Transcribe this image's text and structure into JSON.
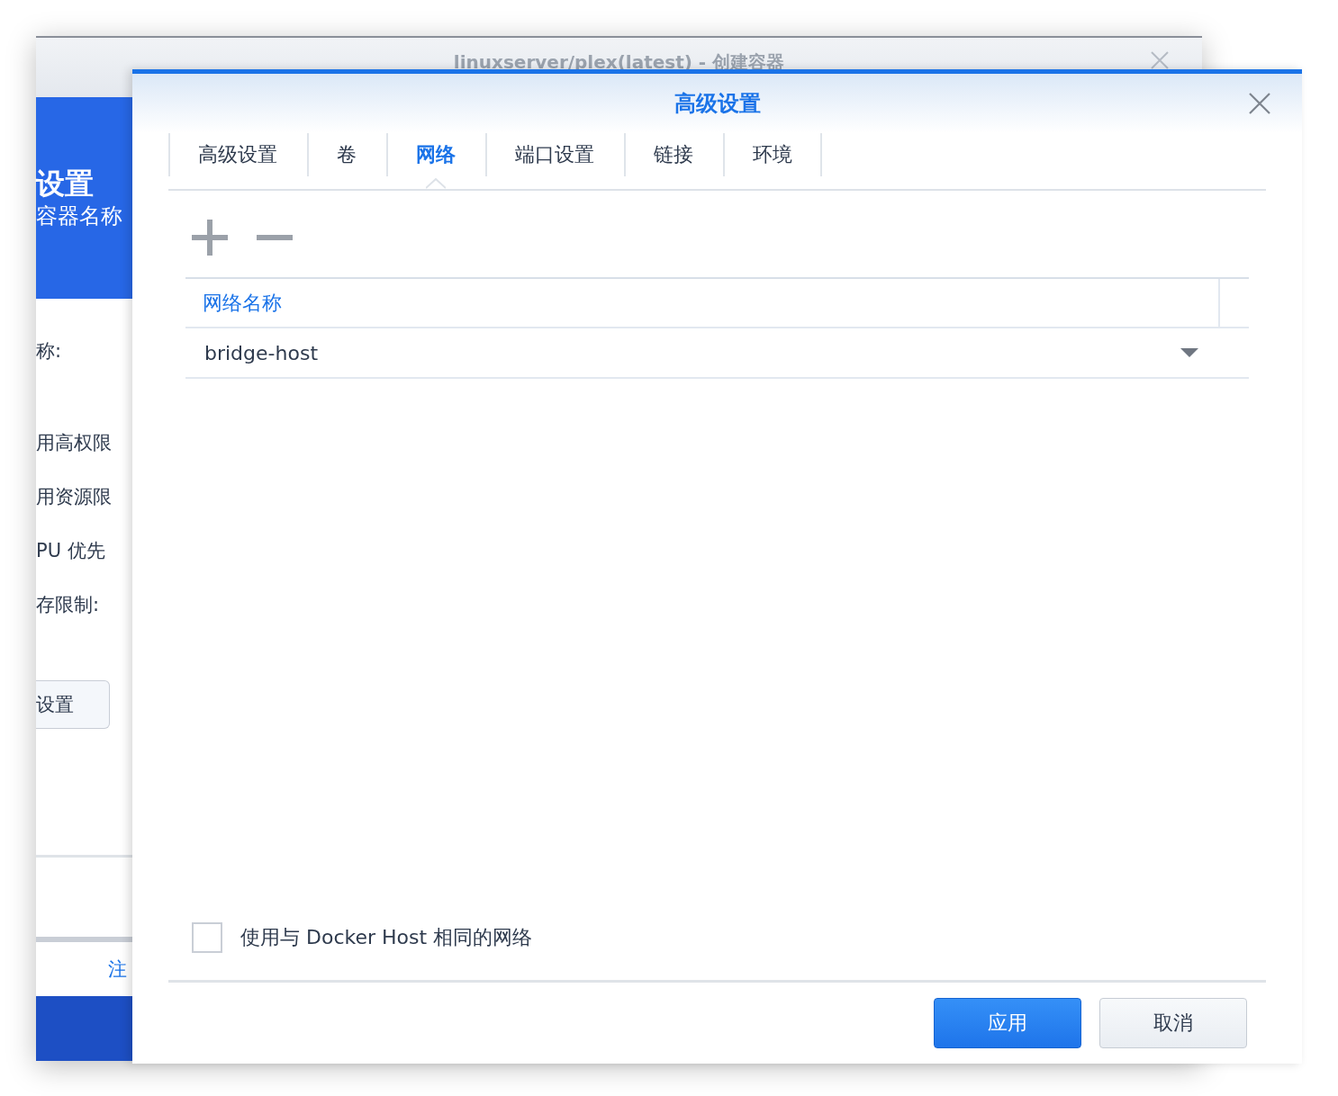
{
  "background_window": {
    "title": "linuxserver/plex(latest) - 创建容器",
    "banner_title": "设置",
    "banner_subtitle": "容器名称",
    "labels": [
      "称:",
      "用高权限",
      "用资源限",
      "PU 优先",
      "存限制:"
    ],
    "button": "设置",
    "link": "注"
  },
  "dialog": {
    "title": "高级设置",
    "tabs": [
      {
        "label": "高级设置",
        "selected": false
      },
      {
        "label": "卷",
        "selected": false
      },
      {
        "label": "网络",
        "selected": true
      },
      {
        "label": "端口设置",
        "selected": false
      },
      {
        "label": "链接",
        "selected": false
      },
      {
        "label": "环境",
        "selected": false
      }
    ],
    "table": {
      "columns": [
        "网络名称"
      ],
      "rows": [
        {
          "network": "bridge-host"
        }
      ]
    },
    "checkbox": {
      "label": "使用与 Docker Host 相同的网络",
      "checked": false
    },
    "buttons": [
      {
        "label": "应用",
        "kind": "primary"
      },
      {
        "label": "取消",
        "kind": "secondary"
      }
    ]
  }
}
